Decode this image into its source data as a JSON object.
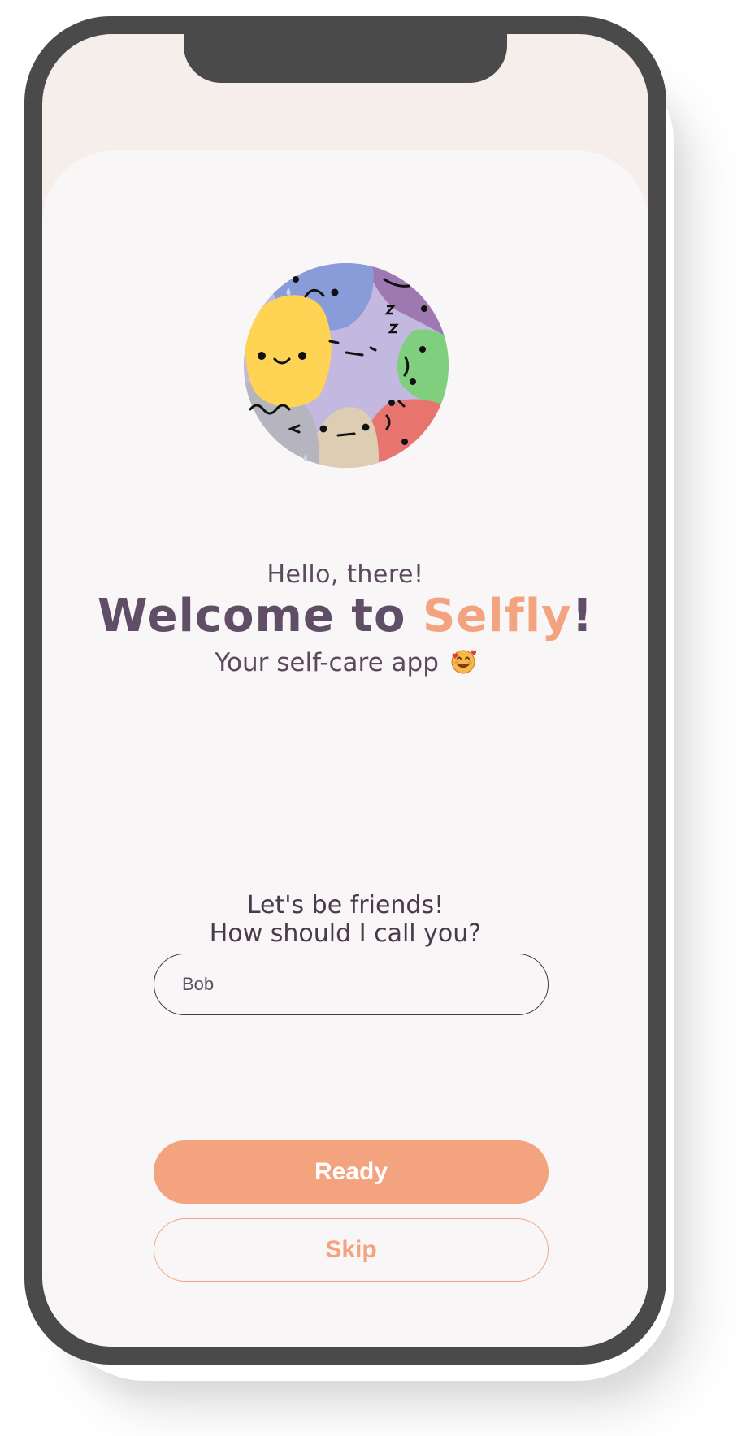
{
  "welcome": {
    "hello": "Hello, there!",
    "title_prefix": "Welcome to ",
    "brand": "Selfly",
    "title_suffix": "!",
    "tagline": "Your self-care app"
  },
  "form": {
    "prompt_line1": "Let's be friends!",
    "prompt_line2": "How should I call you?",
    "name_value": "Bob"
  },
  "actions": {
    "ready_label": "Ready",
    "skip_label": "Skip"
  },
  "colors": {
    "accent": "#f4a37f",
    "title": "#5f4e66",
    "frame": "#4a4a4a",
    "card": "#f9f6f7"
  },
  "icons": {
    "logo": "mood-faces-logo-icon",
    "tagline_emoji": "smiling-face-with-hearts-icon"
  }
}
